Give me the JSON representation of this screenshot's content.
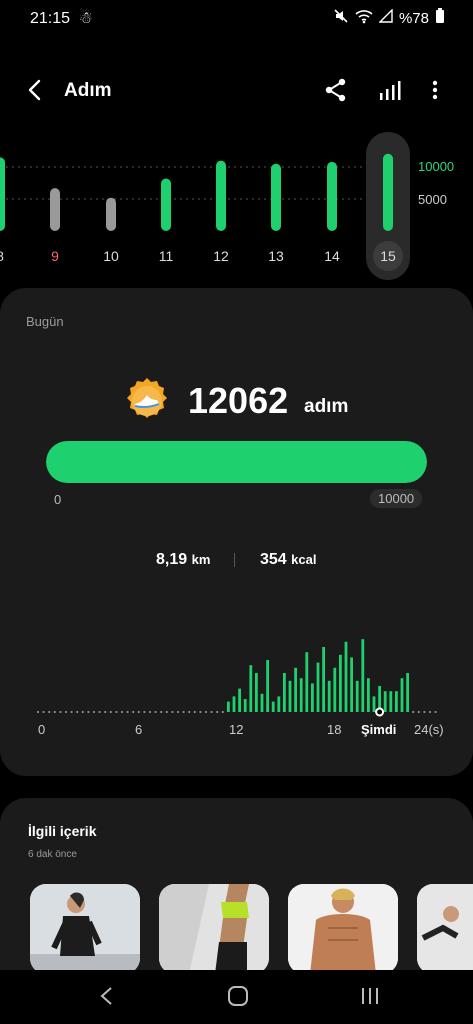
{
  "status": {
    "time": "21:15",
    "battery": "%78"
  },
  "header": {
    "title": "Adım"
  },
  "week": {
    "days": [
      {
        "label": "8",
        "value": 11500,
        "goal_met": true,
        "highlight": false
      },
      {
        "label": "9",
        "value": 6700,
        "goal_met": false,
        "highlight": true
      },
      {
        "label": "10",
        "value": 5200,
        "goal_met": false,
        "highlight": false
      },
      {
        "label": "11",
        "value": 8200,
        "goal_met": true,
        "highlight": false
      },
      {
        "label": "12",
        "value": 11000,
        "goal_met": true,
        "highlight": false
      },
      {
        "label": "13",
        "value": 10500,
        "goal_met": true,
        "highlight": false
      },
      {
        "label": "14",
        "value": 10800,
        "goal_met": true,
        "highlight": false
      },
      {
        "label": "15",
        "value": 12062,
        "goal_met": true,
        "selected": true
      }
    ],
    "axis": {
      "goal": "10000",
      "mid": "5000"
    }
  },
  "today": {
    "label": "Bugün",
    "steps": "12062",
    "unit": "adım",
    "progress": 1.0,
    "goal_min": "0",
    "goal_max": "10000",
    "distance": "8,19",
    "distance_unit": "km",
    "calories": "354",
    "calories_unit": "kcal"
  },
  "hourly": {
    "x_labels": [
      "0",
      "6",
      "12",
      "18",
      "Şimdi",
      "24(s)"
    ],
    "bars": [
      0,
      0,
      0,
      0,
      0,
      0,
      0,
      0,
      0,
      0,
      0,
      0,
      0,
      0,
      0,
      0,
      0,
      0,
      0,
      0,
      0,
      0,
      0,
      0,
      0,
      0,
      0,
      0,
      0,
      0,
      0,
      0,
      0,
      0,
      0.2,
      0.3,
      0.45,
      0.25,
      0.9,
      0.75,
      0.35,
      1.0,
      0.2,
      0.3,
      0.75,
      0.6,
      0.85,
      0.65,
      1.15,
      0.55,
      0.95,
      1.25,
      0.6,
      0.85,
      1.1,
      1.35,
      1.05,
      0.6,
      1.4,
      0.65,
      0.3,
      0.5,
      0.4,
      0.4,
      0.4,
      0.65,
      0.75,
      0,
      0,
      0,
      0,
      0
    ]
  },
  "related": {
    "title": "İlgili içerik",
    "subtitle": "6 dak önce"
  }
}
